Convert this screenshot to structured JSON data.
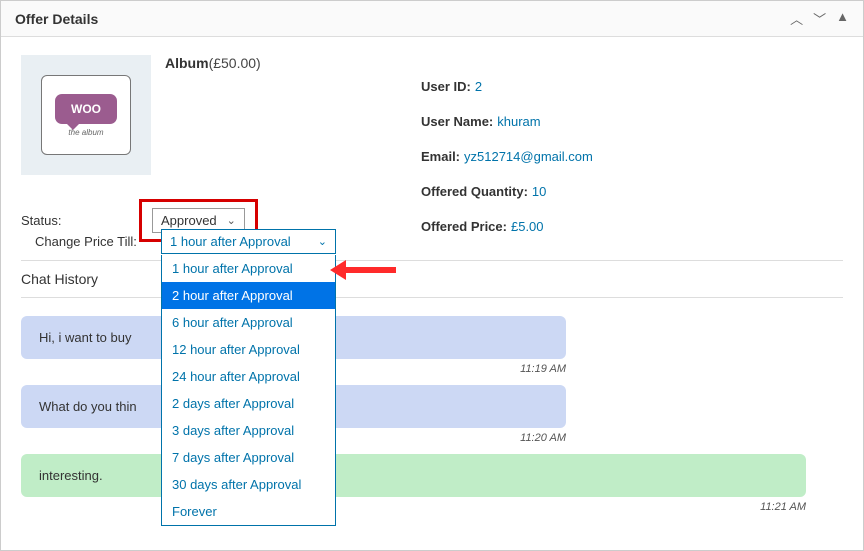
{
  "panel": {
    "title": "Offer Details"
  },
  "product": {
    "name": "Album",
    "price": "(£50.00)",
    "logo_text": "WOO",
    "caption": "the   album"
  },
  "form": {
    "status_label": "Status:",
    "status_value": "Approved",
    "change_price_label": "Change Price Till:",
    "change_price_value": "1 hour after Approval",
    "change_price_options": [
      "1 hour after Approval",
      "2 hour after Approval",
      "6 hour after Approval",
      "12 hour after Approval",
      "24 hour after Approval",
      "2 days after Approval",
      "3 days after Approval",
      "7 days after Approval",
      "30 days after Approval",
      "Forever"
    ],
    "change_price_selected_index": 1
  },
  "user_info": {
    "id_label": "User ID:",
    "id_value": "2",
    "name_label": "User Name:",
    "name_value": "khuram",
    "email_label": "Email:",
    "email_value": "yz512714@gmail.com",
    "qty_label": "Offered Quantity:",
    "qty_value": "10",
    "price_label": "Offered Price:",
    "price_value": "£5.00"
  },
  "chat": {
    "title": "Chat History",
    "messages": [
      {
        "text": "Hi, i want to buy",
        "time": "11:19 AM",
        "side": "user"
      },
      {
        "text": "What do you thin",
        "time": "11:20 AM",
        "side": "user"
      },
      {
        "text": "interesting.",
        "time": "11:21 AM",
        "side": "admin"
      }
    ]
  }
}
